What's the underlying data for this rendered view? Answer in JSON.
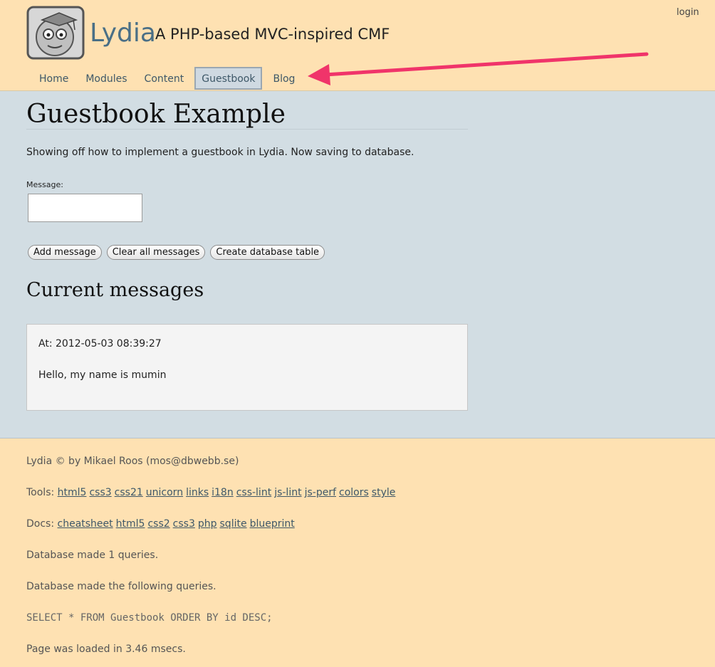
{
  "header": {
    "site_title": "Lydia",
    "slogan": "A PHP-based MVC-inspired CMF",
    "login_label": "login",
    "nav": [
      {
        "label": "Home",
        "selected": false
      },
      {
        "label": "Modules",
        "selected": false
      },
      {
        "label": "Content",
        "selected": false
      },
      {
        "label": "Guestbook",
        "selected": true
      },
      {
        "label": "Blog",
        "selected": false
      }
    ],
    "arrow_color": "#f0346a"
  },
  "main": {
    "title": "Guestbook Example",
    "intro": "Showing off how to implement a guestbook in Lydia. Now saving to database.",
    "form": {
      "message_label": "Message:",
      "message_value": "",
      "buttons": [
        "Add message",
        "Clear all messages",
        "Create database table"
      ]
    },
    "messages_title": "Current messages",
    "messages": [
      {
        "date": "At: 2012-05-03 08:39:27",
        "text": "Hello, my name is mumin"
      }
    ]
  },
  "footer": {
    "credit": "Lydia © by Mikael Roos (mos@dbwebb.se)",
    "tools_label": "Tools:",
    "tools": [
      "html5",
      "css3",
      "css21",
      "unicorn",
      "links",
      "i18n",
      "css-lint",
      "js-lint",
      "js-perf",
      "colors",
      "style"
    ],
    "docs_label": "Docs:",
    "docs": [
      "cheatsheet",
      "html5",
      "css2",
      "css3",
      "php",
      "sqlite",
      "blueprint"
    ],
    "db_count": "Database made 1 queries.",
    "db_queries_label": "Database made the following queries.",
    "sql": "SELECT * FROM Guestbook ORDER BY id DESC;",
    "load_time": "Page was loaded in 3.46 msecs."
  },
  "colors": {
    "header_bg": "#fee1b2",
    "main_bg": "#d2dde3",
    "link": "#3e5868",
    "title_blue": "#4a6f86"
  }
}
